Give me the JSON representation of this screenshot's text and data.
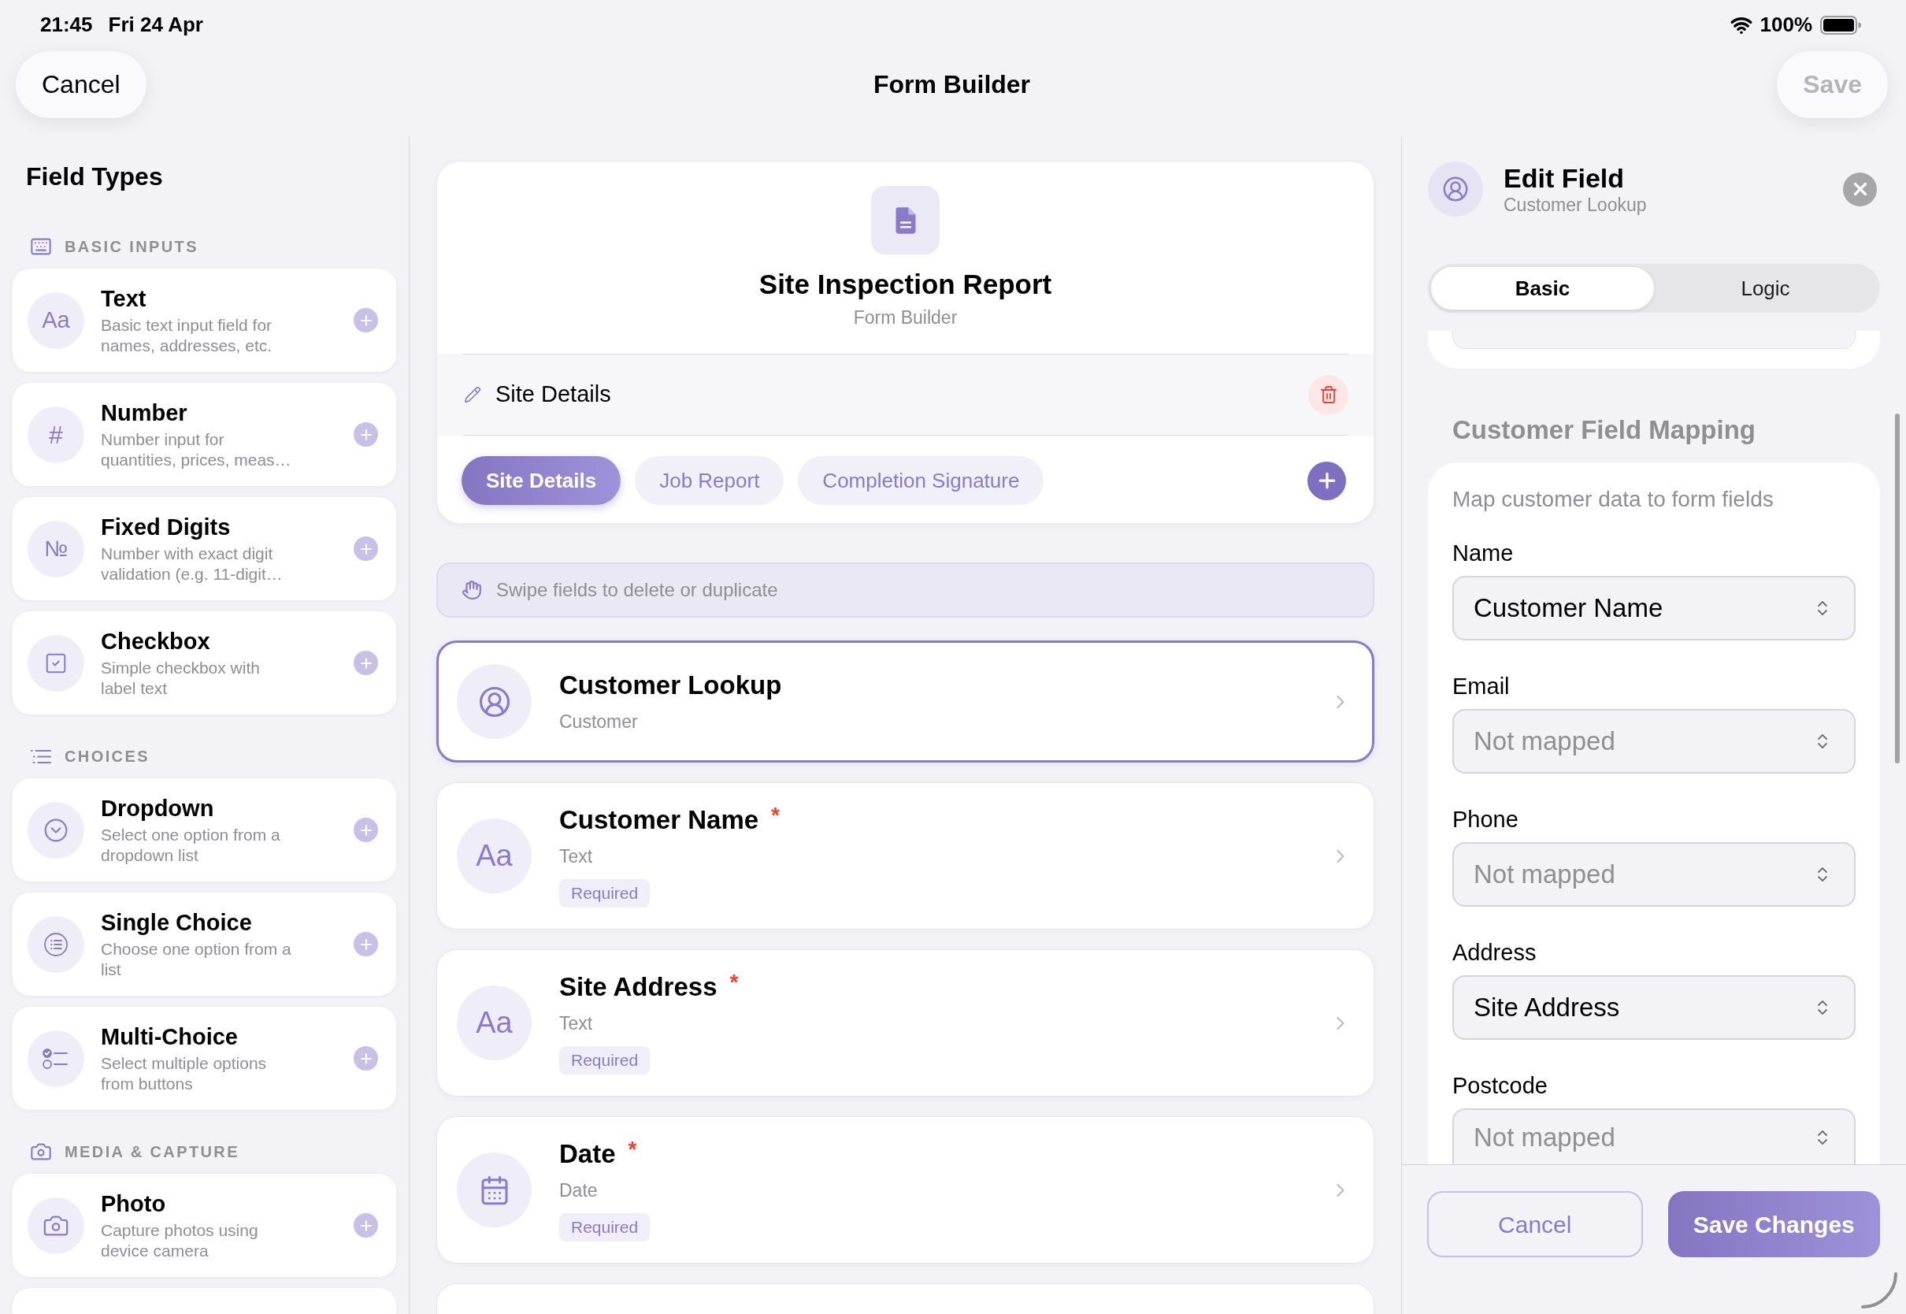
{
  "status_bar": {
    "time": "21:45",
    "date": "Fri 24 Apr",
    "battery": "100%"
  },
  "nav": {
    "cancel": "Cancel",
    "title": "Form Builder",
    "save": {
      "label": "Save",
      "disabled": true
    }
  },
  "field_types": {
    "title": "Field Types",
    "sections": [
      {
        "kind": "keyboard",
        "title": "BASIC INPUTS",
        "items": [
          {
            "kind": "text",
            "glyph": "Aa",
            "title": "Text",
            "description": "Basic text input field for names, addresses, etc."
          },
          {
            "kind": "number",
            "glyph": "#",
            "title": "Number",
            "description": "Number input for quantities, prices, meas…"
          },
          {
            "kind": "fixed_digits",
            "glyph": "№",
            "title": "Fixed Digits",
            "description": "Number with exact digit validation (e.g. 11-digit…"
          },
          {
            "kind": "checkbox",
            "title": "Checkbox",
            "description": "Simple checkbox with label text"
          }
        ]
      },
      {
        "kind": "list",
        "title": "CHOICES",
        "items": [
          {
            "kind": "dropdown",
            "title": "Dropdown",
            "description": "Select one option from a dropdown list"
          },
          {
            "kind": "single_choice",
            "title": "Single Choice",
            "description": "Choose one option from a list"
          },
          {
            "kind": "multi_choice",
            "title": "Multi-Choice",
            "description": "Select multiple options from buttons"
          }
        ]
      },
      {
        "kind": "camera",
        "title": "MEDIA & CAPTURE",
        "items": [
          {
            "kind": "photo",
            "title": "Photo",
            "description": "Capture photos using device camera"
          }
        ]
      }
    ]
  },
  "form": {
    "title": "Site Inspection Report",
    "subtitle": "Form Builder",
    "section_title": "Site Details",
    "pages": [
      {
        "label": "Site Details",
        "selected": true
      },
      {
        "label": "Job Report",
        "selected": false
      },
      {
        "label": "Completion Signature",
        "selected": false
      }
    ],
    "hint": "Swipe fields to delete or duplicate",
    "fields": [
      {
        "kind": "customer",
        "title": "Customer Lookup",
        "type": "Customer",
        "selected": true
      },
      {
        "kind": "text",
        "glyph": "Aa",
        "title": "Customer Name",
        "required_mark": "*",
        "type": "Text",
        "badge": "Required",
        "selected": false
      },
      {
        "kind": "text",
        "glyph": "Aa",
        "title": "Site Address",
        "required_mark": "*",
        "type": "Text",
        "badge": "Required",
        "selected": false
      },
      {
        "kind": "date",
        "title": "Date",
        "required_mark": "*",
        "type": "Date",
        "badge": "Required",
        "selected": false
      }
    ]
  },
  "editor": {
    "title": "Edit Field",
    "subtitle": "Customer Lookup",
    "tabs": [
      {
        "label": "Basic",
        "selected": true
      },
      {
        "label": "Logic",
        "selected": false
      }
    ],
    "mapping": {
      "title": "Customer Field Mapping",
      "description": "Map customer data to form fields",
      "rows": [
        {
          "label": "Name",
          "value": "Customer Name"
        },
        {
          "label": "Email",
          "placeholder": "Not mapped"
        },
        {
          "label": "Phone",
          "placeholder": "Not mapped"
        },
        {
          "label": "Address",
          "value": "Site Address"
        },
        {
          "label": "Postcode",
          "placeholder": "Not mapped"
        }
      ]
    },
    "buttons": {
      "cancel": "Cancel",
      "save": "Save Changes"
    }
  }
}
